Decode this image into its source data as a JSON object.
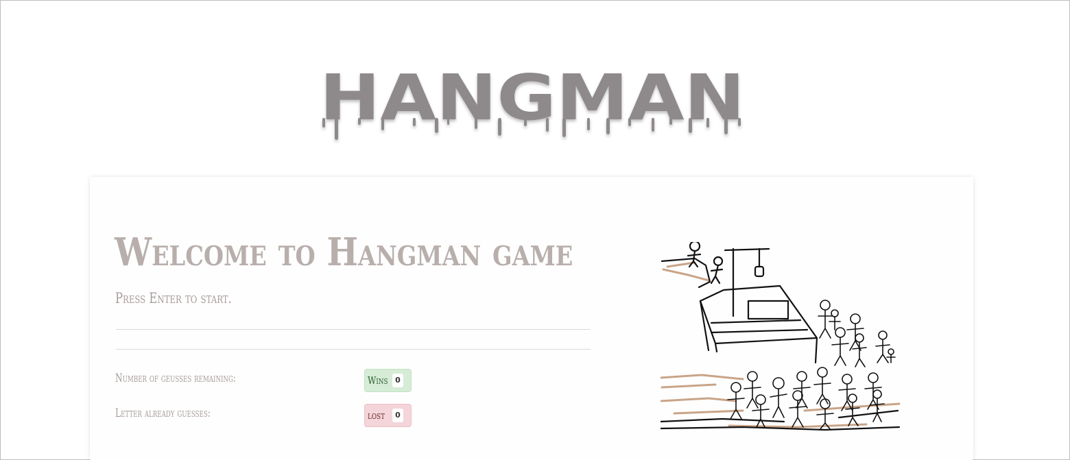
{
  "header": {
    "logo_text": "HANGMAN"
  },
  "main": {
    "welcome_title": "Welcome to Hangman game",
    "prompt": "Press Enter to start.",
    "stats": {
      "guesses_label": "Number of geusses remaining:",
      "letters_label": "Letter already guesses:"
    },
    "score": {
      "wins_label": "Wins",
      "wins_count": "0",
      "lost_label": "lost",
      "lost_count": "0"
    }
  },
  "colors": {
    "logo": "#8e8a8b",
    "title": "#b8afac",
    "wins_bg": "#d6ecd6",
    "lost_bg": "#f4d5d9"
  },
  "images": {
    "illustration": "hand-drawn stick figure crowd watching a gallows"
  }
}
